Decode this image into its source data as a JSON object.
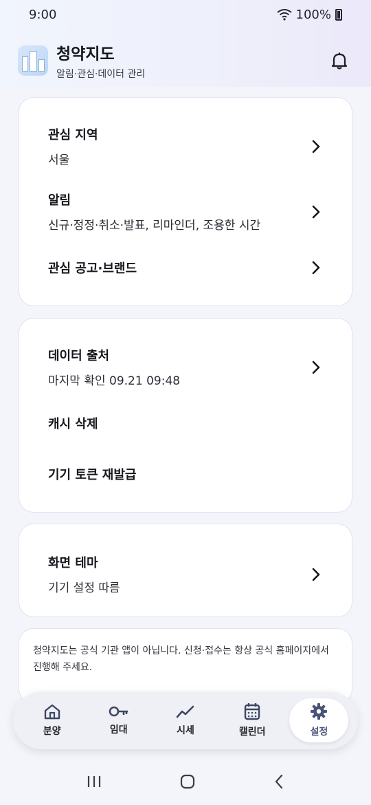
{
  "status_bar": {
    "time": "9:00",
    "battery": "100%"
  },
  "app": {
    "title": "청약지도",
    "subtitle": "알림·관심·데이터 관리"
  },
  "section1": {
    "rows": [
      {
        "title": "관심 지역",
        "subtitle": "서울"
      },
      {
        "title": "알림",
        "subtitle": "신규·정정·취소·발표, 리마인더, 조용한 시간"
      },
      {
        "title": "관심 공고·브랜드"
      }
    ]
  },
  "section2": {
    "rows": [
      {
        "title": "데이터 출처",
        "subtitle": "마지막 확인 09.21 09:48"
      },
      {
        "title": "캐시 삭제"
      },
      {
        "title": "기기 토큰 재발급"
      }
    ]
  },
  "section3": {
    "rows": [
      {
        "title": "화면 테마",
        "subtitle": "기기 설정 따름"
      }
    ]
  },
  "notice": {
    "text": "청약지도는 공식 기관 앱이 아닙니다. 신청·접수는 항상 공식 홈페이지에서 진행해 주세요."
  },
  "bottom_nav": {
    "items": [
      {
        "label": "분양",
        "icon": "home-icon"
      },
      {
        "label": "임대",
        "icon": "key-icon"
      },
      {
        "label": "시세",
        "icon": "trend-icon"
      },
      {
        "label": "캘린더",
        "icon": "calendar-icon"
      },
      {
        "label": "설정",
        "icon": "gear-icon"
      }
    ],
    "active_index": 4
  },
  "colors": {
    "accent": "#4a5278",
    "background": "#f3f5fb",
    "card": "#ffffff"
  }
}
